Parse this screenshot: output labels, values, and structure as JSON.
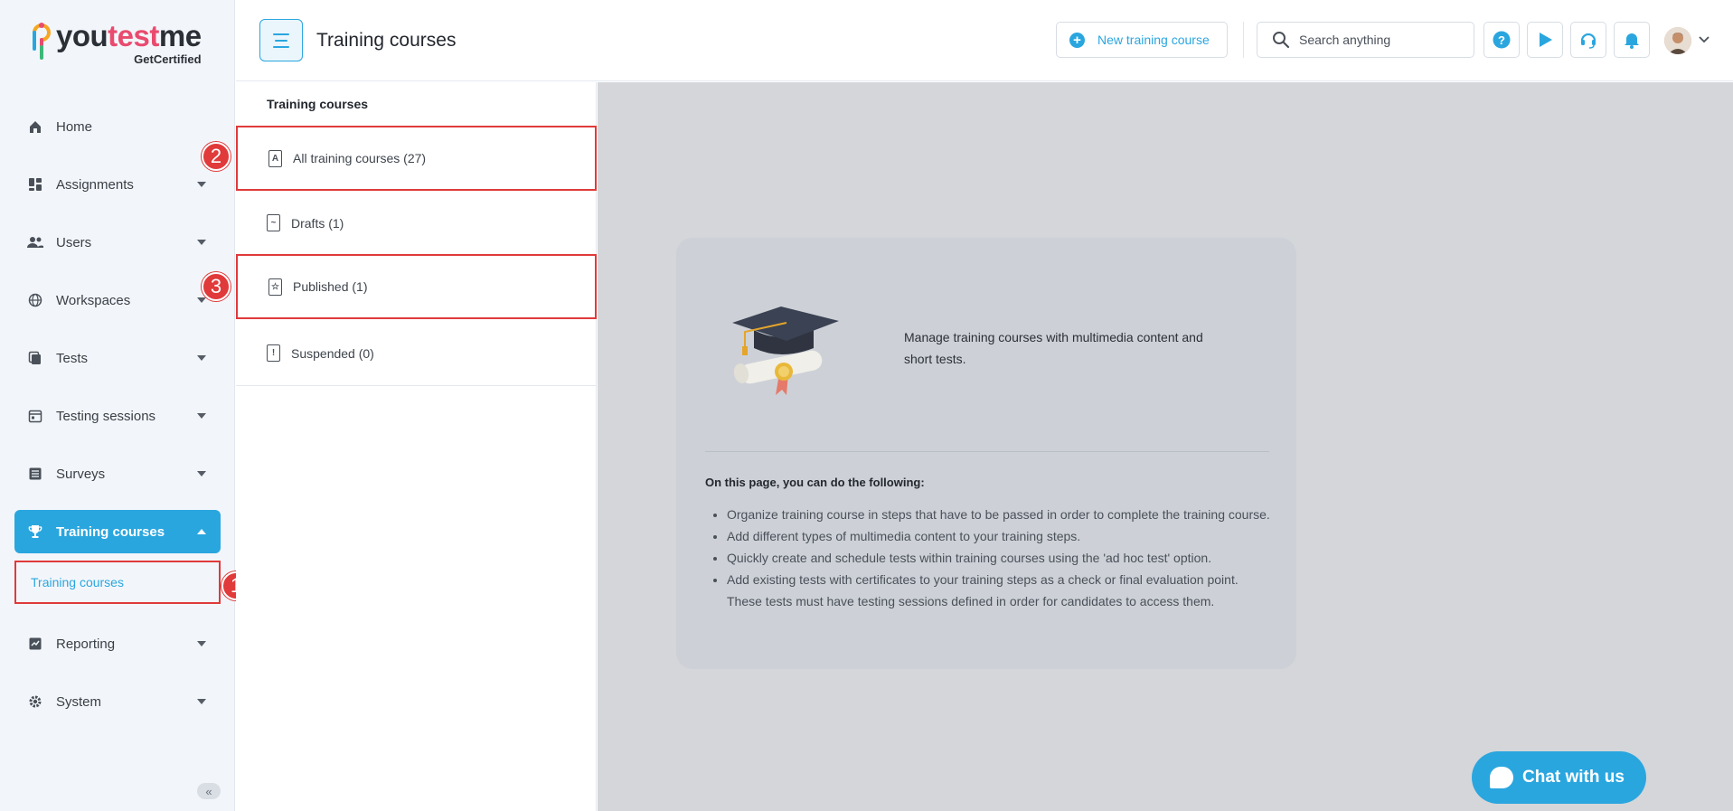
{
  "logo": {
    "name_a": "you",
    "name_b": "test",
    "name_c": "me",
    "sub": "GetCertified"
  },
  "sidebar": {
    "items": [
      {
        "label": "Home",
        "icon": "home-icon",
        "caret": false
      },
      {
        "label": "Assignments",
        "icon": "dashboard-icon",
        "caret": true
      },
      {
        "label": "Users",
        "icon": "users-icon",
        "caret": true
      },
      {
        "label": "Workspaces",
        "icon": "globe-icon",
        "caret": true
      },
      {
        "label": "Tests",
        "icon": "tests-icon",
        "caret": true
      },
      {
        "label": "Testing sessions",
        "icon": "calendar-icon",
        "caret": true
      },
      {
        "label": "Surveys",
        "icon": "list-icon",
        "caret": true
      },
      {
        "label": "Training courses",
        "icon": "trophy-icon",
        "caret": true,
        "active": true
      },
      {
        "label": "Reporting",
        "icon": "chart-icon",
        "caret": true
      },
      {
        "label": "System",
        "icon": "gear-icon",
        "caret": true
      }
    ],
    "sub_item": "Training courses",
    "collapse": "«"
  },
  "badges": [
    "1",
    "2",
    "3"
  ],
  "header": {
    "title": "Training courses",
    "new_button": "New training course",
    "search_placeholder": "Search anything"
  },
  "panel": {
    "title": "Training courses",
    "items": [
      {
        "label": "All training courses (27)",
        "icon": "A"
      },
      {
        "label": "Drafts (1)",
        "icon": "~"
      },
      {
        "label": "Published (1)",
        "icon": "☆"
      },
      {
        "label": "Suspended (0)",
        "icon": "!"
      }
    ]
  },
  "card": {
    "description": "Manage training courses with multimedia content and short tests.",
    "subtitle": "On this page, you can do the following:",
    "bullets": [
      "Organize training course in steps that have to be passed in order to complete the training course.",
      "Add different types of multimedia content to your training steps.",
      "Quickly create and schedule tests within training courses using the 'ad hoc test' option.",
      "Add existing tests with certificates to your training steps as a check or final evaluation point. These tests must have testing sessions defined in order for candidates to access them."
    ]
  },
  "chat": {
    "label": "Chat with us"
  },
  "colors": {
    "accent": "#2aa6df",
    "highlight": "#e03a3a",
    "sidebar_bg": "#f2f6fa",
    "main_bg": "#d4d6d9"
  }
}
